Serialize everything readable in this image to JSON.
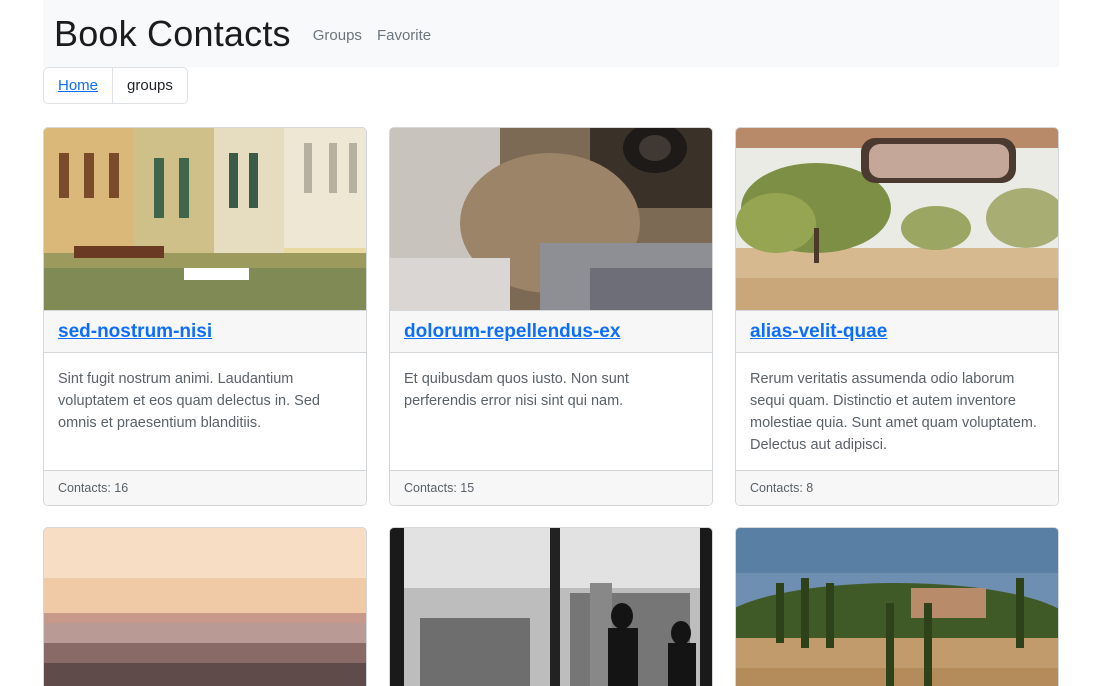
{
  "navbar": {
    "brand": "Book Contacts",
    "links": [
      "Groups",
      "Favorite"
    ]
  },
  "breadcrumb": {
    "home": "Home",
    "current": "groups"
  },
  "groups": [
    {
      "title": "sed-nostrum-nisi",
      "description": "Sint fugit nostrum animi. Laudantium voluptatem et eos quam delectus in. Sed omnis et praesentium blanditiis.",
      "contacts": "Contacts: 16"
    },
    {
      "title": "dolorum-repellendus-ex",
      "description": "Et quibusdam quos iusto. Non sunt perferendis error nisi sint qui nam.",
      "contacts": "Contacts: 15"
    },
    {
      "title": "alias-velit-quae",
      "description": "Rerum veritatis assumenda odio laborum sequi quam. Distinctio et autem inventore molestiae quia. Sunt amet quam voluptatem. Delectus aut adipisci.",
      "contacts": "Contacts: 8"
    }
  ]
}
